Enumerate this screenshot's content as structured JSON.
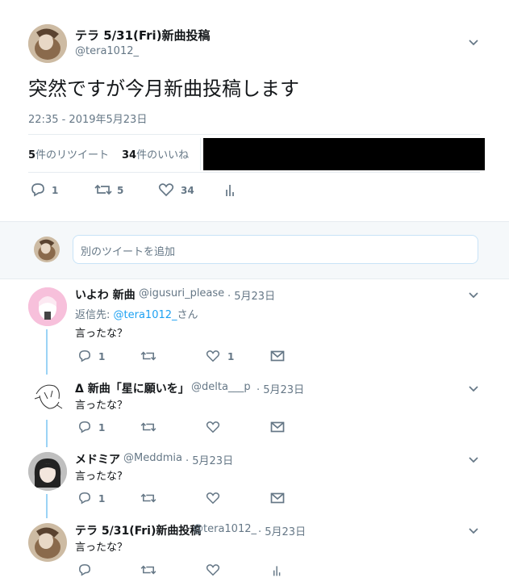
{
  "tweet": {
    "display_name": "テラ 5/31(Fri)新曲投稿",
    "handle": "@tera1012_",
    "text": "突然ですが今月新曲投稿します",
    "timestamp": "22:35 - 2019年5月23日",
    "retweets_count": "5",
    "retweets_label": "件のリツイート",
    "likes_count": "34",
    "likes_label": "件のいいね",
    "action_counts": {
      "reply": "1",
      "retweet": "5",
      "like": "34"
    }
  },
  "compose": {
    "placeholder": "別のツイートを追加"
  },
  "replies": [
    {
      "display_name": "いよわ 新曲",
      "handle": "@igusuri_please",
      "date": "· 5月23日",
      "reply_to_prefix": "返信先: ",
      "reply_to_handle": "@tera1012_",
      "reply_to_suffix": "さん",
      "text": "言ったな？",
      "reply_count": "1",
      "like_count": "1"
    },
    {
      "display_name": "Δ 新曲「星に願いを」",
      "handle": "@delta___p",
      "date": "· 5月23日",
      "text": "言ったな？",
      "reply_count": "1"
    },
    {
      "display_name": "メドミア",
      "handle": "@Meddmia",
      "date": "· 5月23日",
      "text": "言ったな?",
      "reply_count": "1"
    },
    {
      "display_name": "テラ 5/31(Fri)新曲投稿",
      "handle": "@tera1012_",
      "date": "· 5月23日",
      "text": "言ったな？"
    }
  ],
  "colors": {
    "accent": "#1da1f2",
    "muted": "#657786",
    "thread_line": "#9bd3f5"
  }
}
